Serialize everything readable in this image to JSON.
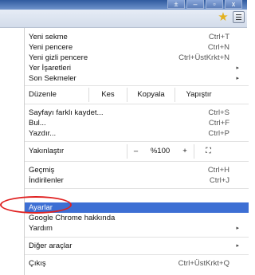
{
  "window": {
    "buttons": [
      "±",
      "–",
      "▫",
      "x"
    ]
  },
  "toolbar": {
    "star_icon": "star-icon",
    "menu_icon": "hamburger-menu-icon"
  },
  "menu": {
    "group1": [
      {
        "label": "Yeni sekme",
        "shortcut": "Ctrl+T"
      },
      {
        "label": "Yeni pencere",
        "shortcut": "Ctrl+N"
      },
      {
        "label": "Yeni gizli pencere",
        "shortcut": "Ctrl+ÜstKrkt+N"
      },
      {
        "label": "Yer İşaretleri",
        "arrow": "▸"
      },
      {
        "label": "Son Sekmeler",
        "arrow": "▸"
      }
    ],
    "edit": {
      "label": "Düzenle",
      "cut": "Kes",
      "copy": "Kopyala",
      "paste": "Yapıştır"
    },
    "group2": [
      {
        "label": "Sayfayı farklı kaydet...",
        "shortcut": "Ctrl+S"
      },
      {
        "label": "Bul...",
        "shortcut": "Ctrl+F"
      },
      {
        "label": "Yazdır...",
        "shortcut": "Ctrl+P"
      }
    ],
    "zoom": {
      "label": "Yakınlaştır",
      "minus": "–",
      "value": "%100",
      "plus": "+",
      "fullscreen": "⛶"
    },
    "group3": [
      {
        "label": "Geçmiş",
        "shortcut": "Ctrl+H"
      },
      {
        "label": "İndirilenler",
        "shortcut": "Ctrl+J"
      }
    ],
    "group4": [
      {
        "label": "Ayarlar"
      },
      {
        "label": "Google Chrome hakkında"
      },
      {
        "label": "Yardım",
        "arrow": "▸"
      }
    ],
    "group5": [
      {
        "label": "Diğer araçlar",
        "arrow": "▸"
      }
    ],
    "exit": {
      "label": "Çıkış",
      "shortcut": "Ctrl+ÜstKrkt+Q"
    }
  },
  "highlight_color": "#e02020",
  "selected_color": "#3d6fd4"
}
